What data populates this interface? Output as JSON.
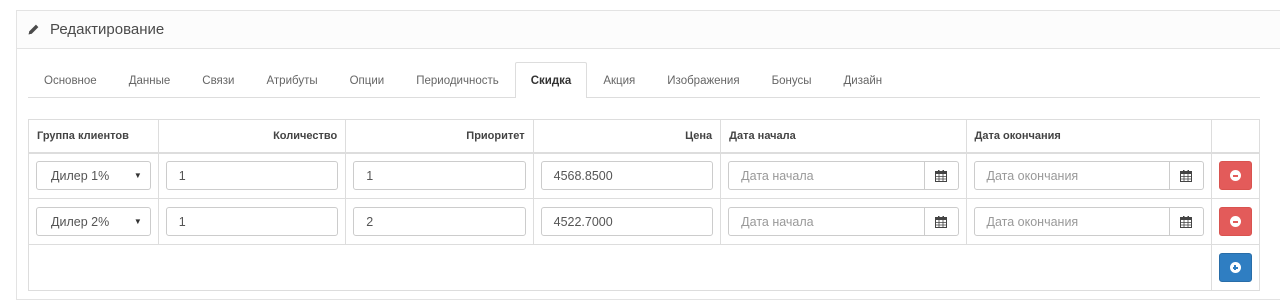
{
  "panel": {
    "title": "Редактирование",
    "title_icon": "pencil-icon"
  },
  "tabs": [
    {
      "label": "Основное",
      "active": false
    },
    {
      "label": "Данные",
      "active": false
    },
    {
      "label": "Связи",
      "active": false
    },
    {
      "label": "Атрибуты",
      "active": false
    },
    {
      "label": "Опции",
      "active": false
    },
    {
      "label": "Периодичность",
      "active": false
    },
    {
      "label": "Скидка",
      "active": true
    },
    {
      "label": "Акция",
      "active": false
    },
    {
      "label": "Изображения",
      "active": false
    },
    {
      "label": "Бонусы",
      "active": false
    },
    {
      "label": "Дизайн",
      "active": false
    }
  ],
  "table": {
    "headers": {
      "group": "Группа клиентов",
      "quantity": "Количество",
      "priority": "Приоритет",
      "price": "Цена",
      "date_start": "Дата начала",
      "date_end": "Дата окончания"
    },
    "rows": [
      {
        "group": "Дилер 1%",
        "quantity": "1",
        "priority": "1",
        "price": "4568.8500",
        "date_start_placeholder": "Дата начала",
        "date_end_placeholder": "Дата окончания"
      },
      {
        "group": "Дилер 2%",
        "quantity": "1",
        "priority": "2",
        "price": "4522.7000",
        "date_start_placeholder": "Дата начала",
        "date_end_placeholder": "Дата окончания"
      }
    ],
    "remove_icon": "minus-circle-icon",
    "add_icon": "plus-circle-icon",
    "calendar_icon": "calendar-icon"
  },
  "colors": {
    "danger": "#e35b5a",
    "primary": "#2f7ec2",
    "border": "#dddddd"
  }
}
